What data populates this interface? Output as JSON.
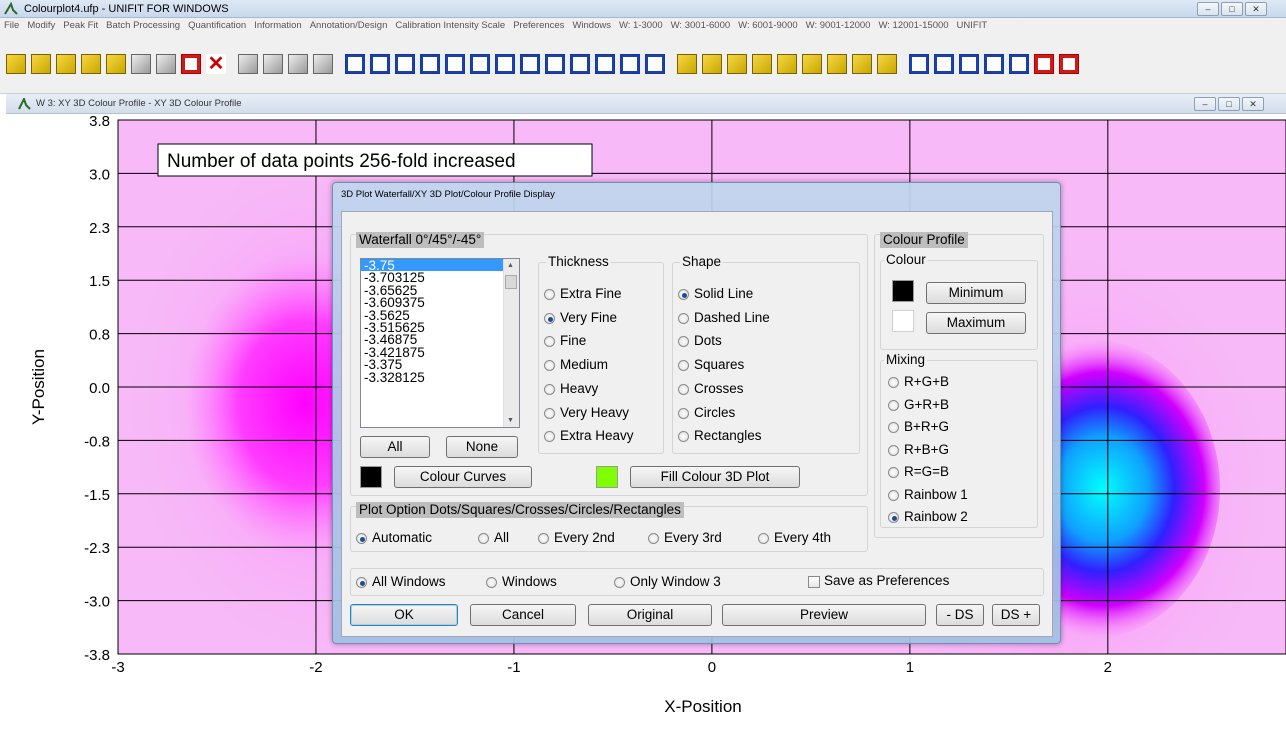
{
  "app": {
    "title": "Colourplot4.ufp - UNIFIT FOR WINDOWS",
    "window_controls": [
      "–",
      "□",
      "✕"
    ]
  },
  "menu": [
    "File",
    "Modify",
    "Peak Fit",
    "Batch Processing",
    "Quantification",
    "Information",
    "Annotation/Design",
    "Calibration Intensity Scale",
    "Preferences",
    "Windows",
    "W: 1-3000",
    "W: 3001-6000",
    "W: 6001-9000",
    "W: 9001-12000",
    "W: 12001-15000",
    "UNIFIT"
  ],
  "toolbar_icons": [
    "open-file-icon",
    "open-folder-icon",
    "save-icon",
    "import-icon",
    "export-icon",
    "print-icon",
    "peak-icon",
    "scale-icon",
    "close-window-icon",
    "image-icon",
    "page-icon",
    "page-icon",
    "grid-icon",
    "plot-icon",
    "plot-icon",
    "plot-icon",
    "plot-icon",
    "plot-icon",
    "plot-icon",
    "plot-icon",
    "plot-icon",
    "plot-icon",
    "plot-icon",
    "plot-icon",
    "plot-icon",
    "chart-icon",
    "chart-icon",
    "chart-icon",
    "chart-icon",
    "chart-icon",
    "chart-icon",
    "chart-icon",
    "chart-icon",
    "chart-icon",
    "layout-icon",
    "layout-icon",
    "tile-icon",
    "tile-icon",
    "tile-icon",
    "tile-icon",
    "tile-icon",
    "tile-icon"
  ],
  "child_window": {
    "title": "W 3: XY 3D Colour Profile - XY 3D Colour Profile",
    "controls": [
      "–",
      "□",
      "✕"
    ]
  },
  "chart_data": {
    "type": "heatmap",
    "title": "",
    "annotation": "Number of data points 256-fold increased",
    "xlabel": "X-Position",
    "ylabel": "Y-Position",
    "xlim": [
      -3,
      2.9
    ],
    "ylim": [
      -3.8,
      3.8
    ],
    "x_ticks": [
      "-3",
      "-2",
      "-1",
      "0",
      "1",
      "2"
    ],
    "y_ticks": [
      "3.8",
      "3.0",
      "2.3",
      "1.5",
      "0.8",
      "0.0",
      "-0.8",
      "-1.5",
      "-2.3",
      "-3.0",
      "-3.8"
    ],
    "grid": true,
    "colormap": "Rainbow 2",
    "colors": {
      "background": "#f7b9f7",
      "magenta": "#ff00ff",
      "blue": "#2030ff",
      "cyan": "#00ffff"
    }
  },
  "dialog": {
    "title": "3D Plot Waterfall/XY 3D Plot/Colour Profile Display",
    "waterfall": {
      "label": "Waterfall 0°/45°/-45°",
      "list": [
        "-3.75",
        "-3.703125",
        "-3.65625",
        "-3.609375",
        "-3.5625",
        "-3.515625",
        "-3.46875",
        "-3.421875",
        "-3.375",
        "-3.328125"
      ],
      "selected": "-3.75",
      "all_button": "All",
      "none_button": "None",
      "colour_curves_button": "Colour Curves",
      "fill_colour_button": "Fill Colour 3D Plot",
      "curve_color": "#000000",
      "fill_color": "#7fff00"
    },
    "thickness": {
      "label": "Thickness",
      "options": [
        "Extra Fine",
        "Very Fine",
        "Fine",
        "Medium",
        "Heavy",
        "Very Heavy",
        "Extra Heavy"
      ],
      "selected": "Very Fine"
    },
    "shape": {
      "label": "Shape",
      "options": [
        "Solid Line",
        "Dashed Line",
        "Dots",
        "Squares",
        "Crosses",
        "Circles",
        "Rectangles"
      ],
      "selected": "Solid Line"
    },
    "colour_profile": {
      "label": "Colour Profile",
      "colour_label": "Colour",
      "minimum_button": "Minimum",
      "maximum_button": "Maximum",
      "minimum_color": "#000000",
      "maximum_color": "#ffffff",
      "mixing_label": "Mixing",
      "mixing_options": [
        "R+G+B",
        "G+R+B",
        "B+R+G",
        "R+B+G",
        "R=G=B",
        "Rainbow 1",
        "Rainbow 2"
      ],
      "mixing_selected": "Rainbow 2"
    },
    "plot_option": {
      "label": "Plot Option Dots/Squares/Crosses/Circles/Rectangles",
      "options": [
        "Automatic",
        "All",
        "Every 2nd",
        "Every 3rd",
        "Every 4th"
      ],
      "selected": "Automatic"
    },
    "window_scope": {
      "options": [
        "All Windows",
        "Windows",
        "Only Window  3"
      ],
      "selected": "All Windows",
      "save_pref_label": "Save as Preferences",
      "save_pref_checked": false
    },
    "buttons": {
      "ok": "OK",
      "cancel": "Cancel",
      "original": "Original",
      "preview": "Preview",
      "ds_minus": "- DS",
      "ds_plus": "DS +"
    }
  }
}
